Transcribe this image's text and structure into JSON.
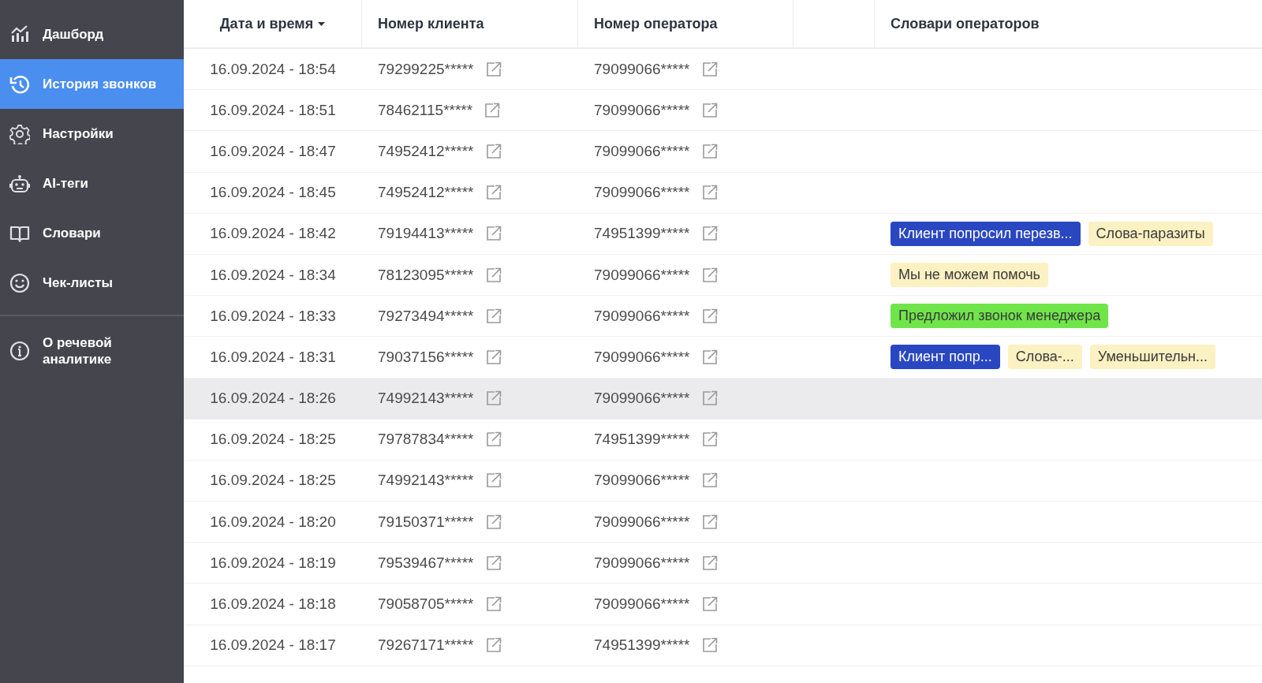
{
  "sidebar": {
    "items": [
      {
        "label": "Дашборд",
        "selected": false
      },
      {
        "label": "История звонков",
        "selected": true
      },
      {
        "label": "Настройки",
        "selected": false
      },
      {
        "label": "AI-теги",
        "selected": false
      },
      {
        "label": "Словари",
        "selected": false
      },
      {
        "label": "Чек-листы",
        "selected": false
      }
    ],
    "footer_item": {
      "label": "О речевой аналитике",
      "selected": false
    }
  },
  "table": {
    "columns": [
      {
        "label": "Дата и время",
        "sorted": true
      },
      {
        "label": "Номер клиента",
        "sorted": false
      },
      {
        "label": "Номер оператора",
        "sorted": false
      },
      {
        "sorted": false
      },
      {
        "label": "Словари операторов",
        "sorted": false
      }
    ],
    "rows": [
      {
        "datetime": "16.09.2024 - 18:54",
        "client": "79299225*****",
        "operator": "79099066*****",
        "hovered": false,
        "tags": []
      },
      {
        "datetime": "16.09.2024 - 18:51",
        "client": "78462115*****",
        "operator": "79099066*****",
        "hovered": false,
        "tags": []
      },
      {
        "datetime": "16.09.2024 - 18:47",
        "client": "74952412*****",
        "operator": "79099066*****",
        "hovered": false,
        "tags": []
      },
      {
        "datetime": "16.09.2024 - 18:45",
        "client": "74952412*****",
        "operator": "79099066*****",
        "hovered": false,
        "tags": []
      },
      {
        "datetime": "16.09.2024 - 18:42",
        "client": "79194413*****",
        "operator": "74951399*****",
        "hovered": false,
        "tags": [
          {
            "label": "Клиент попросил перезв...",
            "color": "#2a47c2"
          },
          {
            "label": "Слова-паразиты",
            "color": "#fbf1c2"
          }
        ]
      },
      {
        "datetime": "16.09.2024 - 18:34",
        "client": "78123095*****",
        "operator": "79099066*****",
        "hovered": false,
        "tags": [
          {
            "label": "Мы не можем помочь",
            "color": "#fbf1c2"
          }
        ]
      },
      {
        "datetime": "16.09.2024 - 18:33",
        "client": "79273494*****",
        "operator": "79099066*****",
        "hovered": false,
        "tags": [
          {
            "label": "Предложил звонок менеджера",
            "color": "#6fe54a"
          }
        ]
      },
      {
        "datetime": "16.09.2024 - 18:31",
        "client": "79037156*****",
        "operator": "79099066*****",
        "hovered": false,
        "tags": [
          {
            "label": "Клиент попр...",
            "color": "#2a47c2"
          },
          {
            "label": "Слова-...",
            "color": "#fbf1c2"
          },
          {
            "label": "Уменьшительн...",
            "color": "#fbf1c2"
          }
        ]
      },
      {
        "datetime": "16.09.2024 - 18:26",
        "client": "74992143*****",
        "operator": "79099066*****",
        "hovered": true,
        "tags": []
      },
      {
        "datetime": "16.09.2024 - 18:25",
        "client": "79787834*****",
        "operator": "74951399*****",
        "hovered": false,
        "tags": []
      },
      {
        "datetime": "16.09.2024 - 18:25",
        "client": "74992143*****",
        "operator": "79099066*****",
        "hovered": false,
        "tags": []
      },
      {
        "datetime": "16.09.2024 - 18:20",
        "client": "79150371*****",
        "operator": "79099066*****",
        "hovered": false,
        "tags": []
      },
      {
        "datetime": "16.09.2024 - 18:19",
        "client": "79539467*****",
        "operator": "79099066*****",
        "hovered": false,
        "tags": []
      },
      {
        "datetime": "16.09.2024 - 18:18",
        "client": "79058705*****",
        "operator": "79099066*****",
        "hovered": false,
        "tags": []
      },
      {
        "datetime": "16.09.2024 - 18:17",
        "client": "79267171*****",
        "operator": "74951399*****",
        "hovered": false,
        "tags": []
      }
    ]
  }
}
